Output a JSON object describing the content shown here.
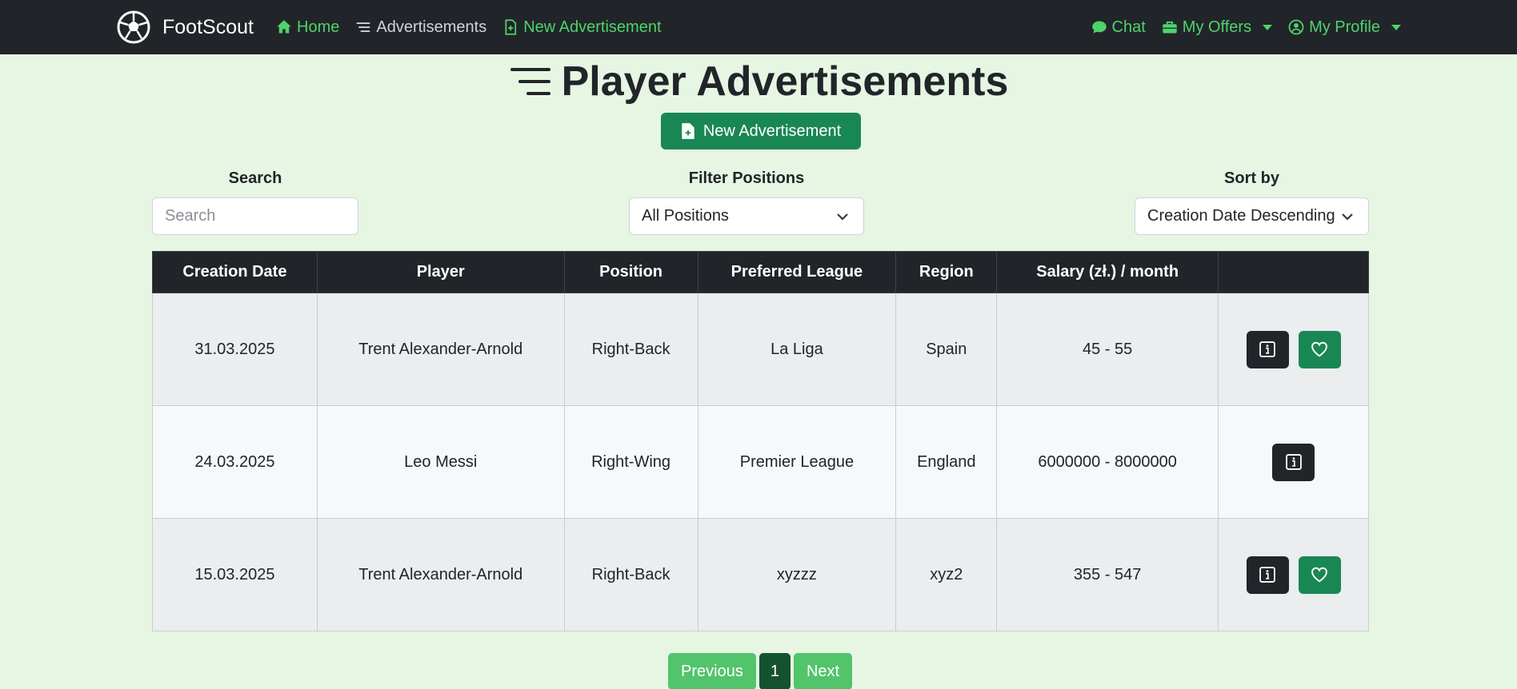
{
  "nav": {
    "brand": "FootScout",
    "left_links": [
      {
        "label": "Home",
        "icon": "house-icon"
      },
      {
        "label": "Advertisements",
        "icon": "list-icon"
      },
      {
        "label": "New Advertisement",
        "icon": "file-plus-icon"
      }
    ],
    "right_links": [
      {
        "label": "Chat",
        "icon": "chat-icon"
      },
      {
        "label": "My Offers",
        "icon": "briefcase-icon"
      },
      {
        "label": "My Profile",
        "icon": "person-circle-icon"
      }
    ]
  },
  "page": {
    "title": "Player Advertisements",
    "new_button": "New Advertisement"
  },
  "filters": {
    "search_label": "Search",
    "search_placeholder": "Search",
    "position_label": "Filter Positions",
    "position_value": "All Positions",
    "sort_label": "Sort by",
    "sort_value": "Creation Date Descending"
  },
  "table": {
    "headers": [
      "Creation Date",
      "Player",
      "Position",
      "Preferred League",
      "Region",
      "Salary (zł.) / month",
      ""
    ],
    "rows": [
      {
        "date": "31.03.2025",
        "player": "Trent Alexander-Arnold",
        "position": "Right-Back",
        "league": "La Liga",
        "region": "Spain",
        "salary": "45 - 55",
        "favorite": true
      },
      {
        "date": "24.03.2025",
        "player": "Leo Messi",
        "position": "Right-Wing",
        "league": "Premier League",
        "region": "England",
        "salary": "6000000 - 8000000",
        "favorite": false
      },
      {
        "date": "15.03.2025",
        "player": "Trent Alexander-Arnold",
        "position": "Right-Back",
        "league": "xyzzz",
        "region": "xyz2",
        "salary": "355 - 547",
        "favorite": true
      }
    ]
  },
  "pagination": {
    "previous": "Previous",
    "current": "1",
    "next": "Next"
  },
  "colors": {
    "navbar": "#212529",
    "accent": "#4fd36b",
    "primary_button": "#198754",
    "background": "#e6f6e3"
  }
}
